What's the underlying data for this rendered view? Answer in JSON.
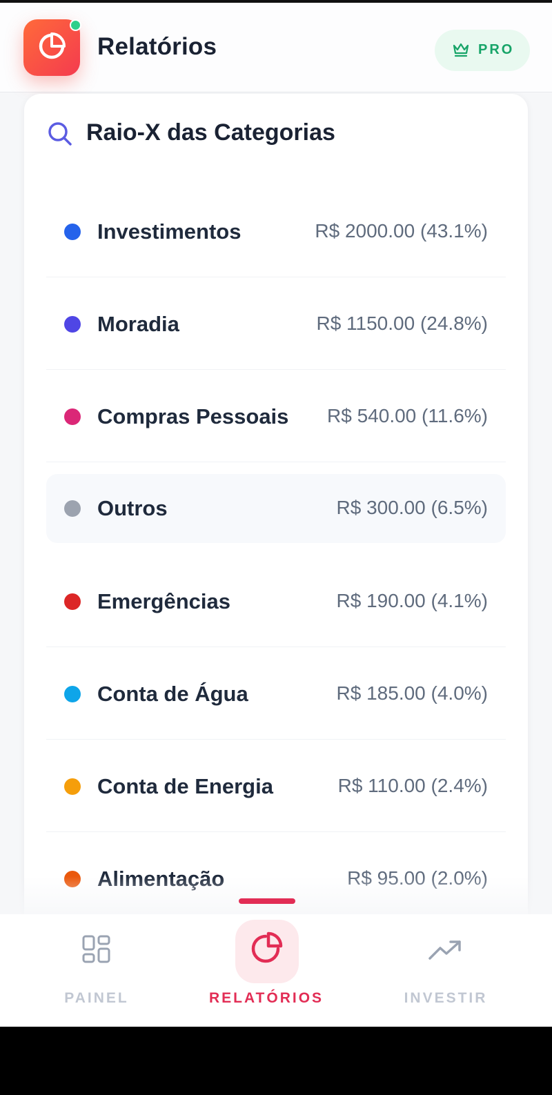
{
  "header": {
    "title": "Relatórios",
    "badge_label": "PRO",
    "badge_icon": "crown-icon"
  },
  "card": {
    "title": "Raio-X das Categorias",
    "title_icon": "search-icon"
  },
  "categories": [
    {
      "name": "Investimentos",
      "value": "R$ 2000.00 (43.1%)",
      "color": "#2563eb"
    },
    {
      "name": "Moradia",
      "value": "R$ 1150.00 (24.8%)",
      "color": "#4f46e5"
    },
    {
      "name": "Compras Pessoais",
      "value": "R$ 540.00 (11.6%)",
      "color": "#db2777"
    },
    {
      "name": "Outros",
      "value": "R$ 300.00 (6.5%)",
      "color": "#9ca3af"
    },
    {
      "name": "Emergências",
      "value": "R$ 190.00 (4.1%)",
      "color": "#dc2626"
    },
    {
      "name": "Conta de Água",
      "value": "R$ 185.00 (4.0%)",
      "color": "#0ea5e9"
    },
    {
      "name": "Conta de Energia",
      "value": "R$ 110.00 (2.4%)",
      "color": "#f59e0b"
    },
    {
      "name": "Alimentação",
      "value": "R$ 95.00 (2.0%)",
      "color": "#ea580c"
    }
  ],
  "nav": {
    "items": [
      {
        "label": "PAINEL",
        "icon": "grid-icon",
        "active": false
      },
      {
        "label": "RELATÓRIOS",
        "icon": "pie-chart-icon",
        "active": true
      },
      {
        "label": "INVESTIR",
        "icon": "trending-up-icon",
        "active": false
      }
    ]
  },
  "colors": {
    "accent": "#e22d55",
    "pro_green": "#17a468",
    "app_icon_gradient": [
      "#ff6a3a",
      "#f43b4f"
    ]
  }
}
